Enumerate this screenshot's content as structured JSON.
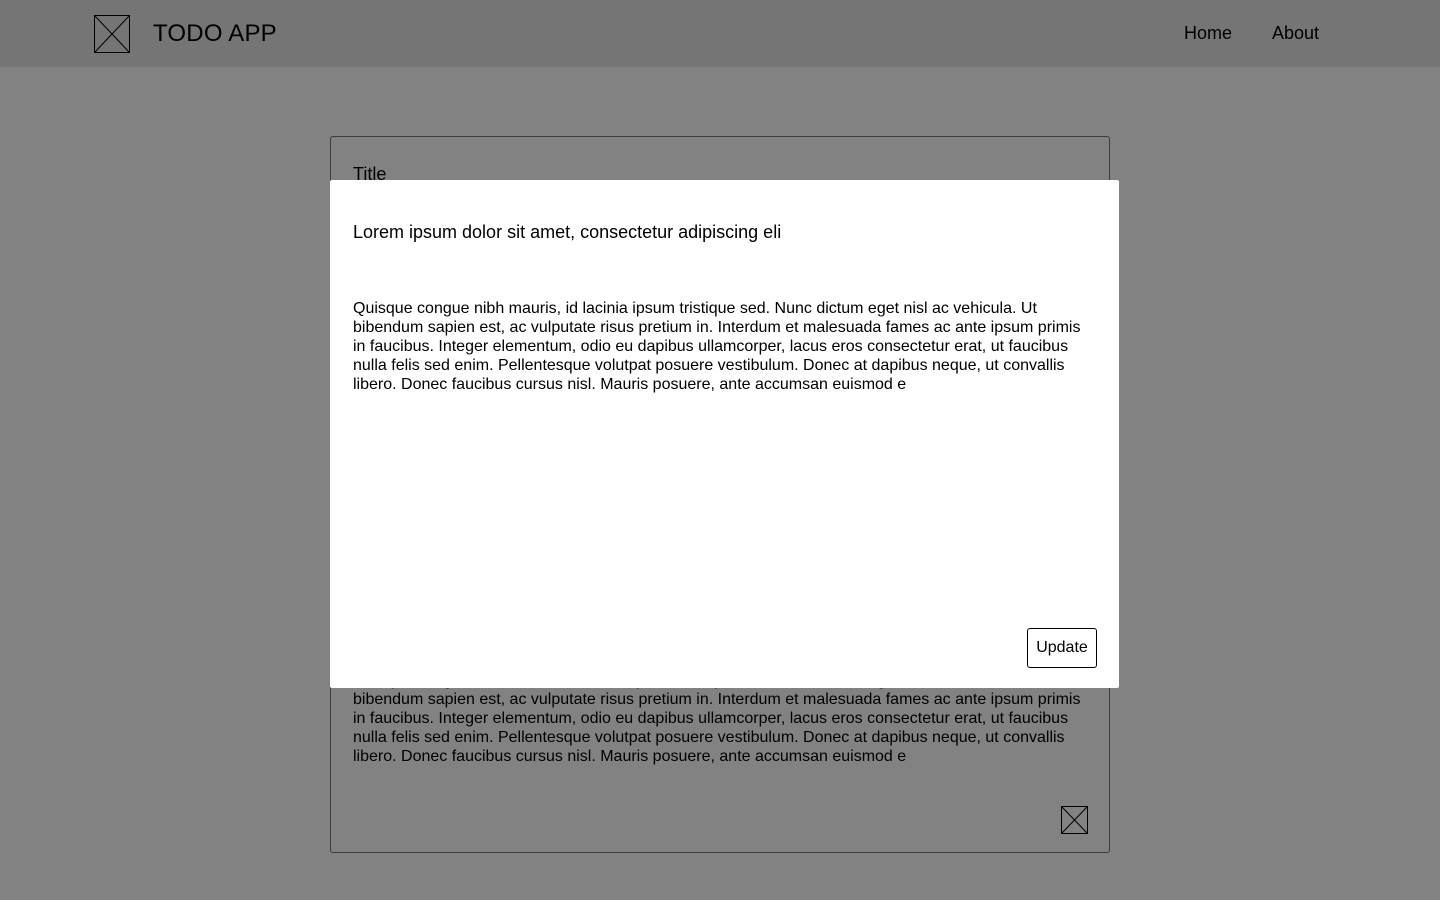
{
  "header": {
    "app_title": "TODO APP",
    "logo_icon": "image-placeholder-icon",
    "nav": {
      "home": "Home",
      "about": "About"
    }
  },
  "todo_card": {
    "title_label": "Title",
    "body": "Quisque congue nibh mauris, id lacinia ipsum tristique sed. Nunc dictum eget nisl ac vehicula. Ut bibendum sapien est, ac vulputate risus pretium in. Interdum et malesuada fames ac ante ipsum primis in faucibus. Integer elementum, odio eu dapibus ullamcorper, lacus eros consectetur erat, ut faucibus nulla felis sed enim. Pellentesque volutpat posuere vestibulum. Donec at dapibus neque, ut convallis libero. Donec faucibus cursus nisl. Mauris posuere, ante accumsan euismod e",
    "delete_icon": "delete-placeholder-icon"
  },
  "modal": {
    "title": "Lorem ipsum dolor sit amet, consectetur adipiscing eli",
    "body": "Quisque congue nibh mauris, id lacinia ipsum tristique sed. Nunc dictum eget nisl ac vehicula. Ut bibendum sapien est, ac vulputate risus pretium in. Interdum et malesuada fames ac ante ipsum primis in faucibus. Integer elementum, odio eu dapibus ullamcorper, lacus eros consectetur erat, ut faucibus nulla felis sed enim. Pellentesque volutpat posuere vestibulum. Donec at dapibus neque, ut convallis libero. Donec faucibus cursus nisl. Mauris posuere, ante accumsan euismod e",
    "update_label": "Update"
  },
  "colors": {
    "overlay": "#000000",
    "header_bg": "#e6e6e6",
    "modal_bg": "#ffffff"
  }
}
